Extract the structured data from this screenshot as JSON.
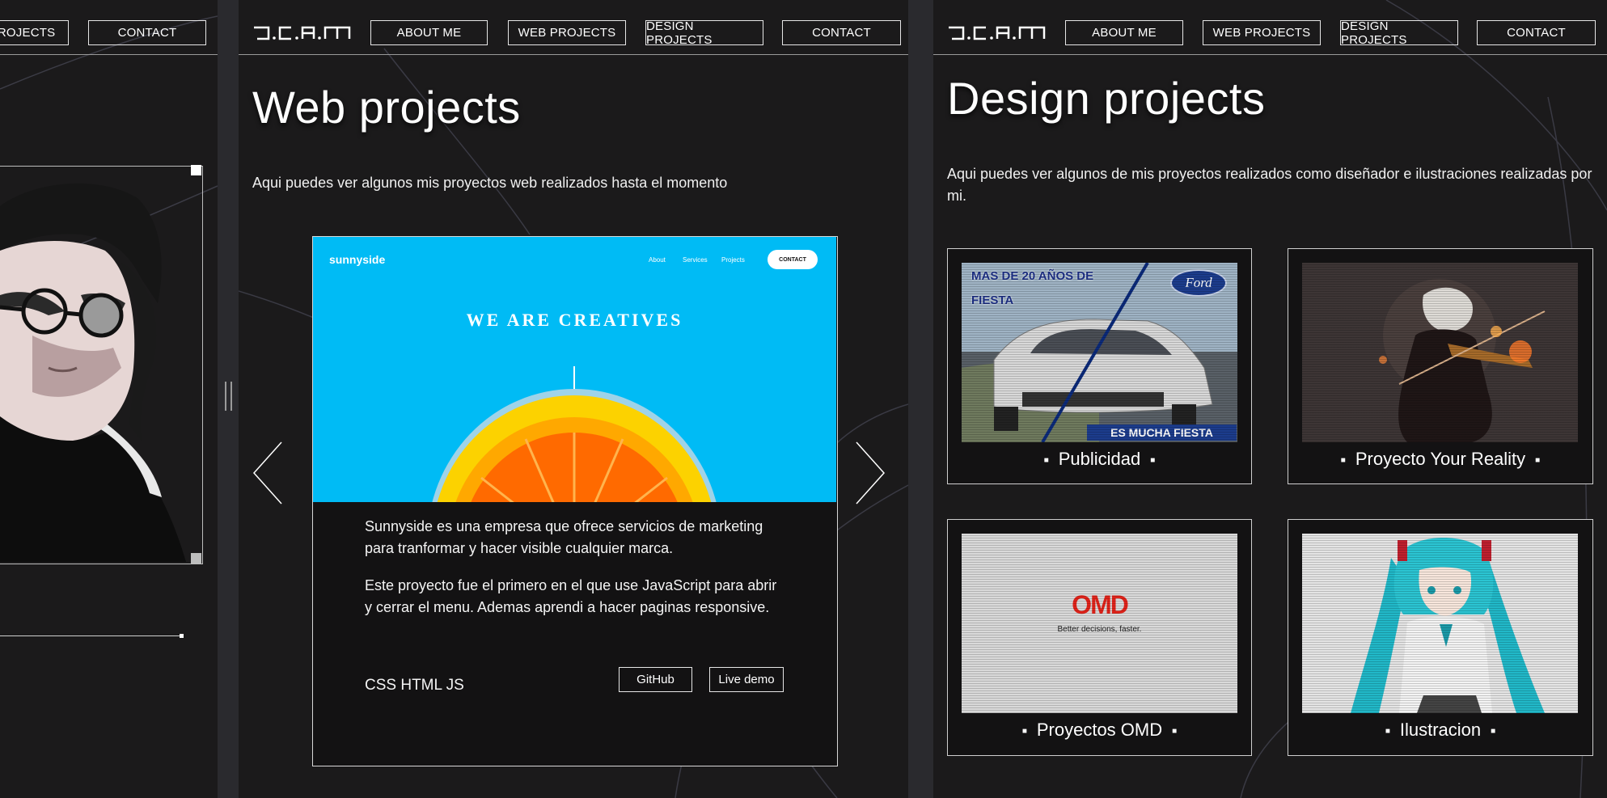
{
  "nav": {
    "logo": "J.C.A.M",
    "about": "ABOUT ME",
    "web": "WEB PROJECTS",
    "design": "DESIGN PROJECTS",
    "contact": "CONTACT",
    "left_projects": "PROJECTS",
    "left_contact": "CONTACT"
  },
  "web": {
    "title": "Web projects",
    "intro": "Aqui puedes ver algunos mis proyectos web realizados hasta el momento",
    "project": {
      "brand": "sunnyside",
      "menu": [
        "About",
        "Services",
        "Projects"
      ],
      "cta": "CONTACT",
      "hero": "WE ARE CREATIVES",
      "desc1": "Sunnyside es una empresa que ofrece servicios de marketing para tranformar y hacer visible cualquier marca.",
      "desc2": "Este proyecto fue el primero en el que use JavaScript para abrir y cerrar el menu. Ademas aprendi a hacer paginas responsive.",
      "stack": "CSS HTML JS",
      "github": "GitHub",
      "demo": "Live demo"
    }
  },
  "design": {
    "title": "Design projects",
    "intro": "Aqui puedes ver algunos de mis proyectos realizados como diseñador e ilustraciones realizadas por mi.",
    "cards": [
      {
        "caption": "Publicidad",
        "ad_line1": "MAS DE 20 AÑOS DE",
        "ad_line2": "FIESTA",
        "brand": "Ford",
        "slogan": "ES MUCHA FIESTA"
      },
      {
        "caption": "Proyecto Your Reality"
      },
      {
        "caption": "Proyectos OMD",
        "logo": "OMD",
        "tagline": "Better decisions, faster."
      },
      {
        "caption": "Ilustracion"
      }
    ]
  },
  "colors": {
    "bg": "#1b1a1b",
    "accent_blue": "#00bbf5",
    "omd_red": "#e2231a"
  }
}
